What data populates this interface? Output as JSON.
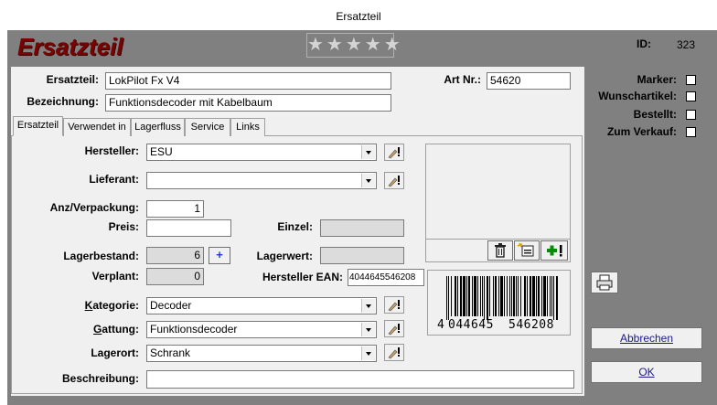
{
  "window": {
    "title": "Ersatzteil"
  },
  "header": {
    "form_title": "Ersatzteil",
    "stars": "★★★★★",
    "id_label": "ID:",
    "id_value": "323"
  },
  "top": {
    "ersatzteil_label": "Ersatzteil:",
    "ersatzteil_value": "LokPilot Fx V4",
    "bezeichnung_label": "Bezeichnung:",
    "bezeichnung_value": "Funktionsdecoder mit Kabelbaum",
    "artnr_label": "Art Nr.:",
    "artnr_value": "54620"
  },
  "flags": {
    "marker": "Marker:",
    "wunschartikel": "Wunschartikel:",
    "bestellt": "Bestellt:",
    "zum_verkauf": "Zum Verkauf:"
  },
  "tabs": [
    "Ersatzteil",
    "Verwendet in",
    "Lagerfluss",
    "Service",
    "Links"
  ],
  "form": {
    "hersteller_label": "Hersteller:",
    "hersteller_value": "ESU",
    "lieferant_label": "Lieferant:",
    "lieferant_value": "",
    "anz_label": "Anz/Verpackung:",
    "anz_value": "1",
    "preis_label": "Preis:",
    "preis_value": "",
    "einzel_label": "Einzel:",
    "einzel_value": "",
    "lagerbestand_label": "Lagerbestand:",
    "lagerbestand_value": "6",
    "plus_label": "+",
    "lagerwert_label": "Lagerwert:",
    "lagerwert_value": "",
    "verplant_label": "Verplant:",
    "verplant_value": "0",
    "ean_label": "Hersteller EAN:",
    "ean_value": "4044645546208",
    "kategorie_label": "Kategorie:",
    "kategorie_value": "Decoder",
    "gattung_label": "Gattung:",
    "gattung_value": "Funktionsdecoder",
    "lagerort_label": "Lagerort:",
    "lagerort_value": "Schrank",
    "beschreibung_label": "Beschreibung:",
    "beschreibung_value": ""
  },
  "barcode": {
    "first_digit": "4",
    "group1": "044645",
    "group2": "546208"
  },
  "buttons": {
    "abbrechen": "Abbrechen",
    "ok": "OK"
  },
  "colors": {
    "title_red": "#7a0000",
    "frame_gray": "#808080",
    "panel": "#f0f0f0",
    "plus_green": "#0a8a0a",
    "plus_blue": "#1a3ccf"
  }
}
